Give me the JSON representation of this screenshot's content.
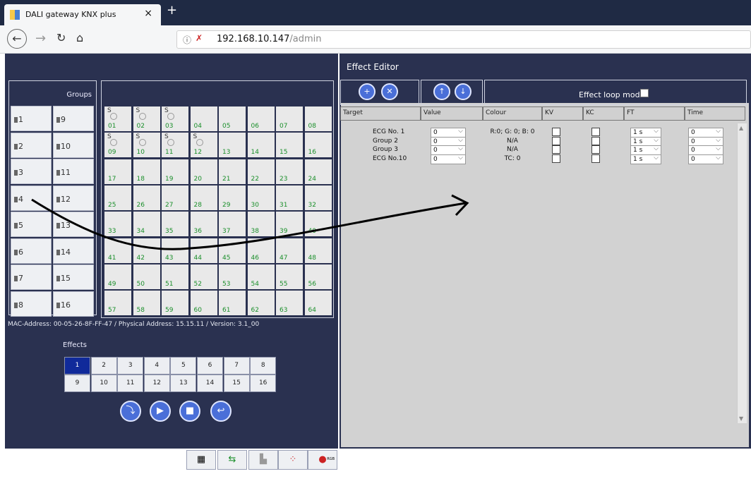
{
  "browser": {
    "tab_title": "DALI gateway KNX plus",
    "url_host": "192.168.10.147",
    "url_path": "/admin"
  },
  "groups": {
    "header": "Groups",
    "items": [
      "1",
      "2",
      "3",
      "4",
      "5",
      "6",
      "7",
      "8",
      "9",
      "10",
      "11",
      "12",
      "13",
      "14",
      "15",
      "16"
    ]
  },
  "ecgs": {
    "numbers": [
      "01",
      "02",
      "03",
      "04",
      "05",
      "06",
      "07",
      "08",
      "09",
      "10",
      "11",
      "12",
      "13",
      "14",
      "15",
      "16",
      "17",
      "18",
      "19",
      "20",
      "21",
      "22",
      "23",
      "24",
      "25",
      "26",
      "27",
      "28",
      "29",
      "30",
      "31",
      "32",
      "33",
      "34",
      "35",
      "36",
      "37",
      "38",
      "39",
      "40",
      "41",
      "42",
      "43",
      "44",
      "45",
      "46",
      "47",
      "48",
      "49",
      "50",
      "51",
      "52",
      "53",
      "54",
      "55",
      "56",
      "57",
      "58",
      "59",
      "60",
      "61",
      "62",
      "63",
      "64"
    ],
    "s_label": "S",
    "with_s": [
      0,
      1,
      2,
      8,
      9,
      10,
      11
    ]
  },
  "mac_info": "MAC-Address: 00-05-26-8F-FF-47 / Physical Address: 15.15.11 / Version: 3.1_00",
  "effects": {
    "label": "Effects",
    "items": [
      "1",
      "2",
      "3",
      "4",
      "5",
      "6",
      "7",
      "8",
      "9",
      "10",
      "11",
      "12",
      "13",
      "14",
      "15",
      "16"
    ],
    "selected": "1"
  },
  "editor": {
    "title": "Effect Editor",
    "loop_label": "Effect loop mode",
    "columns": [
      "Target",
      "Value",
      "Colour",
      "KV",
      "KC",
      "FT",
      "Time"
    ],
    "rows": [
      {
        "target": "ECG No. 1",
        "value": "0",
        "colour": "R:0; G: 0; B: 0",
        "ft": "1 s",
        "time": "0"
      },
      {
        "target": "Group 2",
        "value": "0",
        "colour": "N/A",
        "ft": "1 s",
        "time": "0"
      },
      {
        "target": "Group 3",
        "value": "0",
        "colour": "N/A",
        "ft": "1 s",
        "time": "0"
      },
      {
        "target": "ECG No.10",
        "value": "0",
        "colour": "TC: 0",
        "ft": "1 s",
        "time": "0"
      }
    ]
  },
  "colors": {
    "panel": "#2a3150",
    "accent": "#102a9a",
    "ecg_number": "#1a8f2a",
    "button": "#4a6fd8"
  },
  "bottom_tabs": [
    "table-icon",
    "transfer-icon",
    "group-icon",
    "scene-icon",
    "rgb-icon"
  ],
  "bottom_tab_rgb_text": "RGB"
}
